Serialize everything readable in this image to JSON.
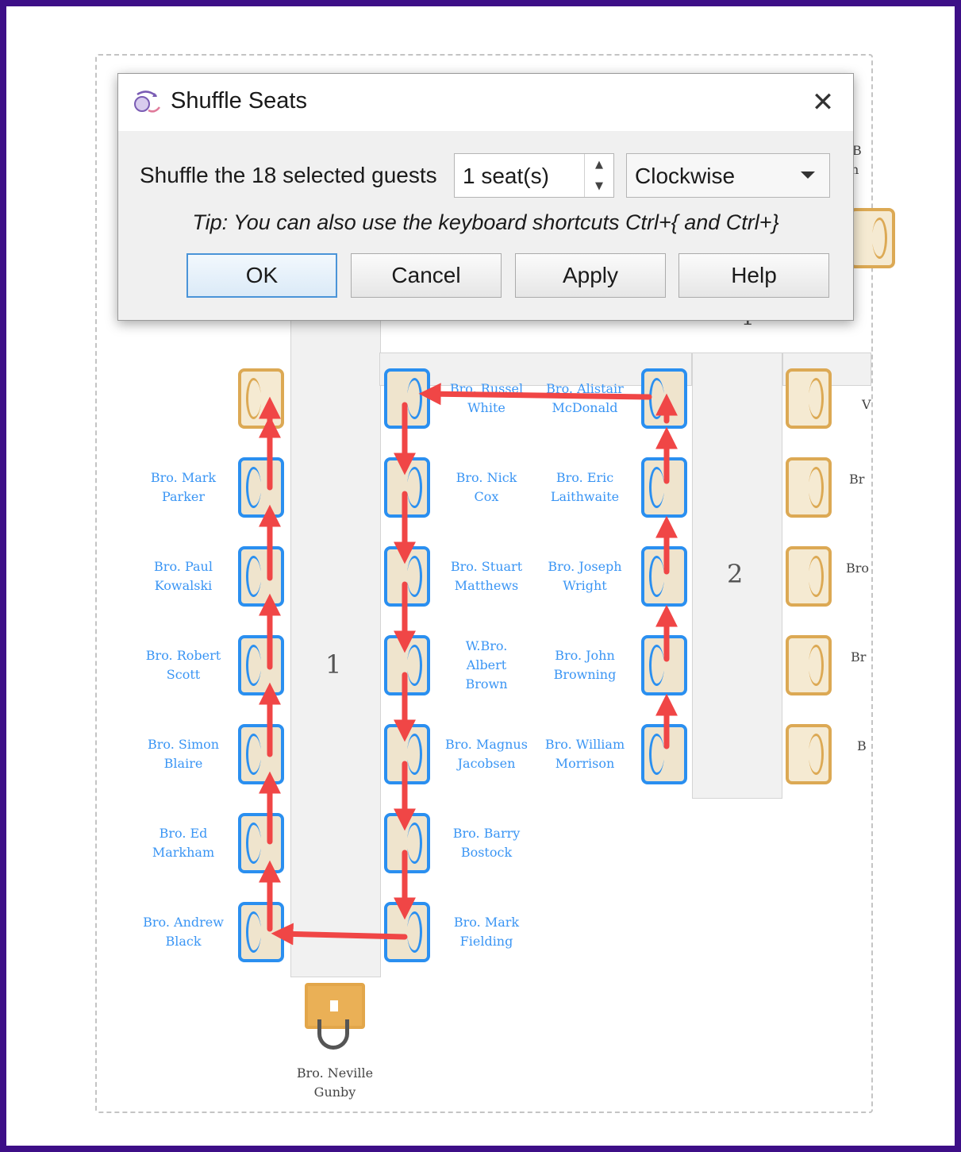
{
  "dialog": {
    "title": "Shuffle Seats",
    "close_symbol": "✕",
    "shuffle_label": "Shuffle the 18 selected guests",
    "seats_value": "1 seat(s)",
    "direction_value": "Clockwise",
    "tip": "Tip: You can also use the keyboard shortcuts Ctrl+{ and Ctrl+}",
    "buttons": {
      "ok": "OK",
      "cancel": "Cancel",
      "apply": "Apply",
      "help": "Help"
    },
    "icon": "shuffle-seats-icon"
  },
  "seating": {
    "table1_number": "1",
    "table2_number": "2",
    "table_top_partial": "1",
    "table1_left_guests": [
      [
        "Bro. Mark",
        "Parker"
      ],
      [
        "Bro. Paul",
        "Kowalski"
      ],
      [
        "Bro. Robert",
        "Scott"
      ],
      [
        "Bro. Simon",
        "Blaire"
      ],
      [
        "Bro. Ed",
        "Markham"
      ],
      [
        "Bro. Andrew",
        "Black"
      ]
    ],
    "table1_right_guests": [
      [
        "Bro. Russel",
        "White"
      ],
      [
        "Bro. Nick",
        "Cox"
      ],
      [
        "Bro. Stuart",
        "Matthews"
      ],
      [
        "W.Bro.",
        "Albert",
        "Brown"
      ],
      [
        "Bro. Magnus",
        "Jacobsen"
      ],
      [
        "Bro. Barry",
        "Bostock"
      ],
      [
        "Bro. Mark",
        "Fielding"
      ]
    ],
    "table2_left_guests": [
      [
        "Bro. Alistair",
        "McDonald"
      ],
      [
        "Bro. Eric",
        "Laithwaite"
      ],
      [
        "Bro. Joseph",
        "Wright"
      ],
      [
        "Bro. John",
        "Browning"
      ],
      [
        "Bro. William",
        "Morrison"
      ]
    ],
    "head_guest": [
      "Bro. Neville",
      "Gunby"
    ],
    "cut_off_labels": [
      "B",
      "n",
      "Br",
      "Bro",
      "Br",
      "B",
      "V"
    ],
    "colors": {
      "frame": "#3d0f87",
      "selected_seat": "#2a8ff0",
      "empty_seat": "#dca954",
      "guest_name": "#3a95f4",
      "arrow": "#f04646"
    }
  }
}
